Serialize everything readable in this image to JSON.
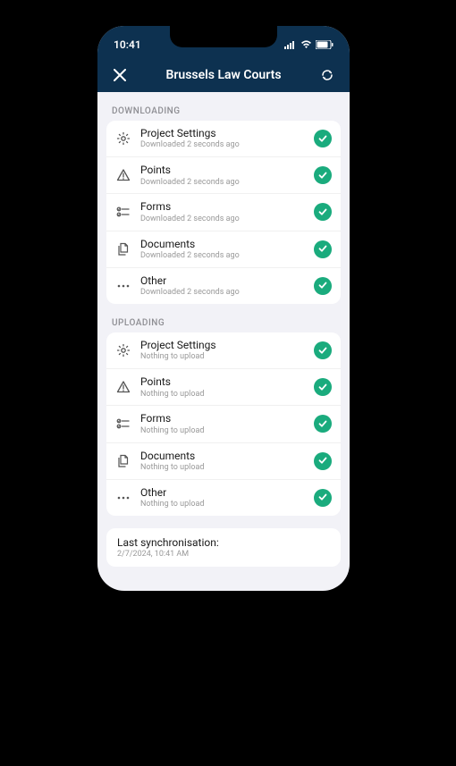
{
  "status": {
    "time": "10:41"
  },
  "nav": {
    "title": "Brussels Law Courts"
  },
  "sections": {
    "downloading": {
      "header": "DOWNLOADING",
      "items": [
        {
          "icon": "gear-icon",
          "title": "Project Settings",
          "sub": "Downloaded 2 seconds ago"
        },
        {
          "icon": "warning-icon",
          "title": "Points",
          "sub": "Downloaded 2 seconds ago"
        },
        {
          "icon": "checklist-icon",
          "title": "Forms",
          "sub": "Downloaded 2 seconds ago"
        },
        {
          "icon": "documents-icon",
          "title": "Documents",
          "sub": "Downloaded 2 seconds ago"
        },
        {
          "icon": "more-icon",
          "title": "Other",
          "sub": "Downloaded 2 seconds ago"
        }
      ]
    },
    "uploading": {
      "header": "UPLOADING",
      "items": [
        {
          "icon": "gear-icon",
          "title": "Project Settings",
          "sub": "Nothing to upload"
        },
        {
          "icon": "warning-icon",
          "title": "Points",
          "sub": "Nothing to upload"
        },
        {
          "icon": "checklist-icon",
          "title": "Forms",
          "sub": "Nothing to upload"
        },
        {
          "icon": "documents-icon",
          "title": "Documents",
          "sub": "Nothing to upload"
        },
        {
          "icon": "more-icon",
          "title": "Other",
          "sub": "Nothing to upload"
        }
      ]
    }
  },
  "sync": {
    "title": "Last synchronisation:",
    "date": "2/7/2024, 10:41 AM"
  }
}
